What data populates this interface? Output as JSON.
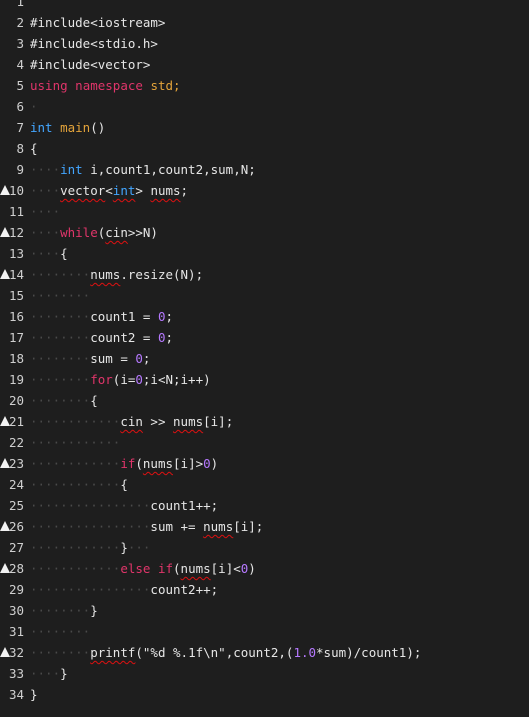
{
  "lines": [
    {
      "no": "1",
      "warn": false,
      "tokens": []
    },
    {
      "no": "2",
      "warn": false,
      "tokens": [
        {
          "t": "#include<iostream>",
          "c": "pp"
        }
      ]
    },
    {
      "no": "3",
      "warn": false,
      "tokens": [
        {
          "t": "#include<stdio.h>",
          "c": "pp"
        }
      ]
    },
    {
      "no": "4",
      "warn": false,
      "tokens": [
        {
          "t": "#include<vector>",
          "c": "pp"
        }
      ]
    },
    {
      "no": "5",
      "warn": false,
      "tokens": [
        {
          "t": "using",
          "c": "kw"
        },
        {
          "t": " ",
          "c": "ws"
        },
        {
          "t": "namespace",
          "c": "kw"
        },
        {
          "t": " ",
          "c": "ws"
        },
        {
          "t": "std;",
          "c": "fn"
        }
      ]
    },
    {
      "no": "6",
      "warn": false,
      "tokens": [
        {
          "t": "·",
          "c": "ws"
        }
      ]
    },
    {
      "no": "7",
      "warn": false,
      "tokens": [
        {
          "t": "int",
          "c": "ty"
        },
        {
          "t": " ",
          "c": "ws"
        },
        {
          "t": "main",
          "c": "fn"
        },
        {
          "t": "()",
          "c": "pp"
        }
      ]
    },
    {
      "no": "8",
      "warn": false,
      "tokens": [
        {
          "t": "{",
          "c": "pp"
        }
      ]
    },
    {
      "no": "9",
      "warn": false,
      "tokens": [
        {
          "t": "····",
          "c": "ws"
        },
        {
          "t": "int",
          "c": "ty"
        },
        {
          "t": " ",
          "c": "ws"
        },
        {
          "t": "i,count1,count2,sum,N;",
          "c": "pp"
        }
      ]
    },
    {
      "no": "10",
      "warn": true,
      "tokens": [
        {
          "t": "····",
          "c": "ws"
        },
        {
          "t": "vector",
          "c": "pp",
          "sq": true
        },
        {
          "t": "<",
          "c": "pp"
        },
        {
          "t": "int",
          "c": "ty",
          "sq": true
        },
        {
          "t": ">",
          "c": "pp"
        },
        {
          "t": " ",
          "c": "ws"
        },
        {
          "t": "nums",
          "c": "pp",
          "sq": true
        },
        {
          "t": ";",
          "c": "pp"
        }
      ]
    },
    {
      "no": "11",
      "warn": false,
      "tokens": [
        {
          "t": "····",
          "c": "ws"
        }
      ]
    },
    {
      "no": "12",
      "warn": true,
      "tokens": [
        {
          "t": "····",
          "c": "ws"
        },
        {
          "t": "while",
          "c": "kw"
        },
        {
          "t": "(",
          "c": "pp"
        },
        {
          "t": "cin",
          "c": "pp",
          "sq": true
        },
        {
          "t": ">>N)",
          "c": "pp"
        }
      ]
    },
    {
      "no": "13",
      "warn": false,
      "tokens": [
        {
          "t": "····",
          "c": "ws"
        },
        {
          "t": "{",
          "c": "pp"
        }
      ]
    },
    {
      "no": "14",
      "warn": true,
      "tokens": [
        {
          "t": "········",
          "c": "ws"
        },
        {
          "t": "nums",
          "c": "pp",
          "sq": true
        },
        {
          "t": ".resize(N);",
          "c": "pp"
        }
      ]
    },
    {
      "no": "15",
      "warn": false,
      "tokens": [
        {
          "t": "········",
          "c": "ws"
        }
      ]
    },
    {
      "no": "16",
      "warn": false,
      "tokens": [
        {
          "t": "········",
          "c": "ws"
        },
        {
          "t": "count1",
          "c": "pp"
        },
        {
          "t": " ",
          "c": "ws"
        },
        {
          "t": "=",
          "c": "pp"
        },
        {
          "t": " ",
          "c": "ws"
        },
        {
          "t": "0",
          "c": "num"
        },
        {
          "t": ";",
          "c": "pp"
        }
      ]
    },
    {
      "no": "17",
      "warn": false,
      "tokens": [
        {
          "t": "········",
          "c": "ws"
        },
        {
          "t": "count2",
          "c": "pp"
        },
        {
          "t": " ",
          "c": "ws"
        },
        {
          "t": "=",
          "c": "pp"
        },
        {
          "t": " ",
          "c": "ws"
        },
        {
          "t": "0",
          "c": "num"
        },
        {
          "t": ";",
          "c": "pp"
        }
      ]
    },
    {
      "no": "18",
      "warn": false,
      "tokens": [
        {
          "t": "········",
          "c": "ws"
        },
        {
          "t": "sum",
          "c": "pp"
        },
        {
          "t": " ",
          "c": "ws"
        },
        {
          "t": "=",
          "c": "pp"
        },
        {
          "t": " ",
          "c": "ws"
        },
        {
          "t": "0",
          "c": "num"
        },
        {
          "t": ";",
          "c": "pp"
        }
      ]
    },
    {
      "no": "19",
      "warn": false,
      "tokens": [
        {
          "t": "········",
          "c": "ws"
        },
        {
          "t": "for",
          "c": "kw"
        },
        {
          "t": "(i=",
          "c": "pp"
        },
        {
          "t": "0",
          "c": "num"
        },
        {
          "t": ";i<N;i++)",
          "c": "pp"
        }
      ]
    },
    {
      "no": "20",
      "warn": false,
      "tokens": [
        {
          "t": "········",
          "c": "ws"
        },
        {
          "t": "{",
          "c": "pp"
        }
      ]
    },
    {
      "no": "21",
      "warn": true,
      "tokens": [
        {
          "t": "············",
          "c": "ws"
        },
        {
          "t": "cin",
          "c": "pp",
          "sq": true
        },
        {
          "t": " ",
          "c": "ws"
        },
        {
          "t": ">>",
          "c": "pp"
        },
        {
          "t": " ",
          "c": "ws"
        },
        {
          "t": "nums",
          "c": "pp",
          "sq": true
        },
        {
          "t": "[i];",
          "c": "pp"
        }
      ]
    },
    {
      "no": "22",
      "warn": false,
      "tokens": [
        {
          "t": "············",
          "c": "ws"
        }
      ]
    },
    {
      "no": "23",
      "warn": true,
      "tokens": [
        {
          "t": "············",
          "c": "ws"
        },
        {
          "t": "if",
          "c": "kw"
        },
        {
          "t": "(",
          "c": "pp"
        },
        {
          "t": "nums",
          "c": "pp",
          "sq": true
        },
        {
          "t": "[i]>",
          "c": "pp"
        },
        {
          "t": "0",
          "c": "num"
        },
        {
          "t": ")",
          "c": "pp"
        }
      ]
    },
    {
      "no": "24",
      "warn": false,
      "tokens": [
        {
          "t": "············",
          "c": "ws"
        },
        {
          "t": "{",
          "c": "pp"
        }
      ]
    },
    {
      "no": "25",
      "warn": false,
      "tokens": [
        {
          "t": "················",
          "c": "ws"
        },
        {
          "t": "count1++;",
          "c": "pp"
        }
      ]
    },
    {
      "no": "26",
      "warn": true,
      "tokens": [
        {
          "t": "················",
          "c": "ws"
        },
        {
          "t": "sum",
          "c": "pp"
        },
        {
          "t": " ",
          "c": "ws"
        },
        {
          "t": "+=",
          "c": "pp"
        },
        {
          "t": " ",
          "c": "ws"
        },
        {
          "t": "nums",
          "c": "pp",
          "sq": true
        },
        {
          "t": "[i];",
          "c": "pp"
        }
      ]
    },
    {
      "no": "27",
      "warn": false,
      "tokens": [
        {
          "t": "············",
          "c": "ws"
        },
        {
          "t": "}",
          "c": "pp"
        },
        {
          "t": "···",
          "c": "ws"
        }
      ]
    },
    {
      "no": "28",
      "warn": true,
      "tokens": [
        {
          "t": "············",
          "c": "ws"
        },
        {
          "t": "else",
          "c": "kw"
        },
        {
          "t": " ",
          "c": "ws"
        },
        {
          "t": "if",
          "c": "kw"
        },
        {
          "t": "(",
          "c": "pp"
        },
        {
          "t": "nums",
          "c": "pp",
          "sq": true
        },
        {
          "t": "[i]<",
          "c": "pp"
        },
        {
          "t": "0",
          "c": "num"
        },
        {
          "t": ")",
          "c": "pp"
        }
      ]
    },
    {
      "no": "29",
      "warn": false,
      "tokens": [
        {
          "t": "················",
          "c": "ws"
        },
        {
          "t": "count2++;",
          "c": "pp"
        }
      ]
    },
    {
      "no": "30",
      "warn": false,
      "tokens": [
        {
          "t": "········",
          "c": "ws"
        },
        {
          "t": "}",
          "c": "pp"
        }
      ]
    },
    {
      "no": "31",
      "warn": false,
      "tokens": [
        {
          "t": "········",
          "c": "ws"
        }
      ]
    },
    {
      "no": "32",
      "warn": true,
      "tokens": [
        {
          "t": "········",
          "c": "ws"
        },
        {
          "t": "printf",
          "c": "pp",
          "sq": true
        },
        {
          "t": "(\"%d",
          "c": "pp"
        },
        {
          "t": " ",
          "c": "ws"
        },
        {
          "t": "%.1f\\n\",count2,(",
          "c": "pp"
        },
        {
          "t": "1.0",
          "c": "num"
        },
        {
          "t": "*sum)/count1);",
          "c": "pp"
        }
      ]
    },
    {
      "no": "33",
      "warn": false,
      "tokens": [
        {
          "t": "····",
          "c": "ws"
        },
        {
          "t": "}",
          "c": "pp"
        }
      ]
    },
    {
      "no": "34",
      "warn": false,
      "tokens": [
        {
          "t": "}",
          "c": "pp"
        }
      ]
    }
  ],
  "colors": {
    "background": "#1e1e1e",
    "keyword": "#e0356a",
    "type": "#43a6ff",
    "function": "#e3a33a",
    "number": "#b679ff",
    "error_squiggle": "#dd1111",
    "warning_icon": "#f2f2f2"
  }
}
